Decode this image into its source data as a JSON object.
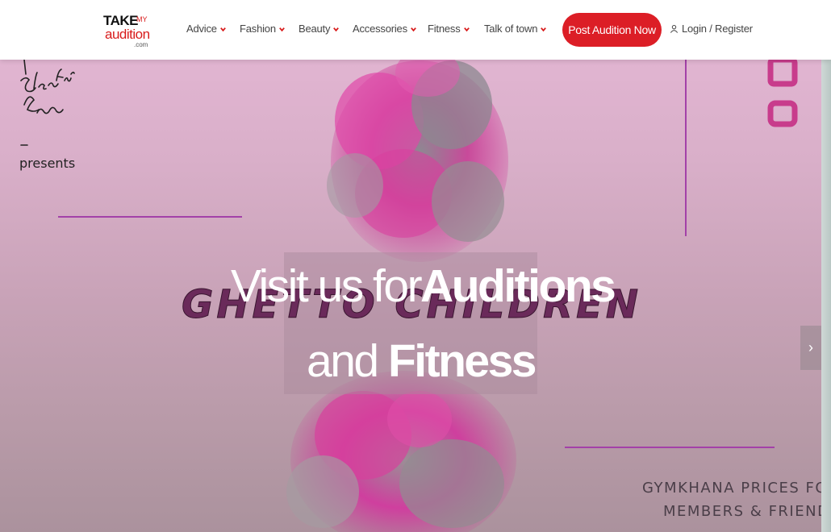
{
  "logo": {
    "take": "TAKE",
    "my": "MY",
    "audition": "audition",
    "com": ".com"
  },
  "nav": {
    "items": [
      {
        "label": "Advice"
      },
      {
        "label": "Fashion"
      },
      {
        "label": "Beauty"
      },
      {
        "label": "Accessories"
      },
      {
        "label": "Fitness"
      },
      {
        "label": "Talk of town"
      }
    ],
    "post_button": "Post Audition Now",
    "login": "Login / Register"
  },
  "hero": {
    "headline_line1_light": "Visit us for",
    "headline_line1_bold": "Auditions",
    "headline_line2_light": "and ",
    "headline_line2_bold": "Fitness",
    "poster_presents": "presents",
    "poster_band": "GHETTO CHILDREN",
    "poster_note_line1": "GYMKHANA PRICES FOR",
    "poster_note_line2": "MEMBERS & FRIENDS",
    "next_arrow": "›"
  },
  "colors": {
    "accent": "#dc1e26",
    "chevron": "#d81b1b",
    "poster_purple": "#7a2b74",
    "poster_pink": "#e0369c"
  }
}
